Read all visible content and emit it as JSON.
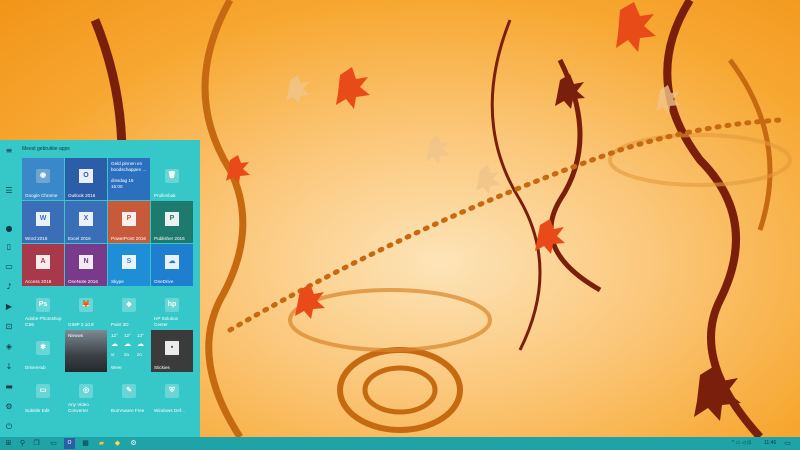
{
  "start_menu": {
    "title": "Meest gebruikte apps",
    "tiles": [
      {
        "label": "Google Chrome",
        "icon": "chrome-icon",
        "glyph": "◉",
        "color": "#3a88c7"
      },
      {
        "label": "Outlook 2016",
        "icon": "outlook-icon",
        "glyph": "O",
        "color": "#2b5da8"
      },
      {
        "label": "Geld pinnen en boodschappen ...",
        "sub": "dinsdag 19",
        "sub2": "15:00",
        "icon": "calendar-icon",
        "color": "#2b6fbf"
      },
      {
        "label": "Prullenbak",
        "icon": "recycle-bin-icon",
        "glyph": "🗑",
        "color": "#36c7c8"
      },
      {
        "label": "Word 2016",
        "icon": "word-icon",
        "glyph": "W",
        "color": "#3a6fb8"
      },
      {
        "label": "Excel 2016",
        "icon": "excel-icon",
        "glyph": "X",
        "color": "#3a6fb8"
      },
      {
        "label": "PowerPoint 2016",
        "icon": "powerpoint-icon",
        "glyph": "P",
        "color": "#c85a3c"
      },
      {
        "label": "Publisher 2016",
        "icon": "publisher-icon",
        "glyph": "P",
        "color": "#1f7a6e"
      },
      {
        "label": "Access 2016",
        "icon": "access-icon",
        "glyph": "A",
        "color": "#a8394a"
      },
      {
        "label": "OneNote 2016",
        "icon": "onenote-icon",
        "glyph": "N",
        "color": "#7a3a8c"
      },
      {
        "label": "Skype",
        "icon": "skype-icon",
        "glyph": "S",
        "color": "#1e8fd6"
      },
      {
        "label": "OneDrive",
        "icon": "onedrive-icon",
        "glyph": "☁",
        "color": "#1e7fd1"
      },
      {
        "label": "Adobe Photoshop CS6",
        "icon": "photoshop-icon",
        "glyph": "Ps",
        "color": "#36c7c8"
      },
      {
        "label": "GIMP 2.10.8",
        "icon": "gimp-icon",
        "glyph": "🦊",
        "color": "#36c7c8"
      },
      {
        "label": "Paint 3D",
        "icon": "paint3d-icon",
        "glyph": "◆",
        "color": "#36c7c8"
      },
      {
        "label": "HP Solution Center",
        "icon": "hp-icon",
        "glyph": "hp",
        "color": "#36c7c8"
      },
      {
        "label": "DriverHub",
        "icon": "driverhub-icon",
        "glyph": "✱",
        "color": "#36c7c8"
      },
      {
        "label": "Nieuws",
        "icon": "news-icon",
        "color": "#4d5258"
      },
      {
        "label": "Weer",
        "icon": "weather-icon",
        "color": "#36c7c8"
      },
      {
        "label": "Stickies",
        "icon": "stickies-icon",
        "glyph": "▪",
        "color": "#3b3b3b"
      },
      {
        "label": "Subtitle Edit",
        "icon": "subtitle-edit-icon",
        "glyph": "▭",
        "color": "#36c7c8"
      },
      {
        "label": "Any Video Converter",
        "icon": "video-converter-icon",
        "glyph": "◎",
        "color": "#36c7c8"
      },
      {
        "label": "BurnAware Free",
        "icon": "burnaware-icon",
        "glyph": "✎",
        "color": "#36c7c8"
      },
      {
        "label": "Windows Def...",
        "icon": "windows-defender-icon",
        "glyph": "⛨",
        "color": "#36c7c8"
      }
    ],
    "weather": {
      "temps": [
        "12°",
        "12°",
        "13°"
      ],
      "days": [
        "vr",
        "za",
        "zo"
      ]
    }
  },
  "rail": {
    "items": [
      "hamburger-icon",
      "list-icon",
      "avatar-icon",
      "document-icon",
      "picture-icon",
      "music-icon",
      "video-icon",
      "network-icon",
      "3d-objects-icon",
      "download-icon",
      "folder-icon",
      "settings-icon",
      "power-icon"
    ]
  },
  "taskbar": {
    "items": [
      "windows-start-icon",
      "search-icon",
      "task-view-icon",
      "outlook-taskbar-icon",
      "calendar-taskbar-icon",
      "file-explorer-icon",
      "store-icon",
      "chrome-taskbar-icon",
      "settings-taskbar-icon"
    ],
    "clock": "11:46",
    "tray": "^ ▭ ◁ ⊡"
  }
}
